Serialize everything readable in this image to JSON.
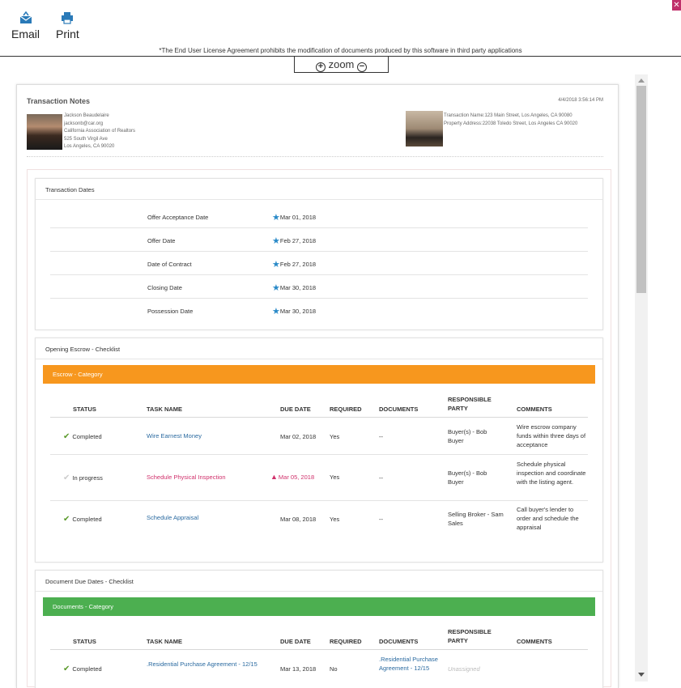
{
  "toolbar": {
    "email_label": "Email",
    "print_label": "Print",
    "close_label": "✕",
    "eula_note": "*The End User License Agreement prohibits the modification of documents produced by this software in third party applications",
    "zoom_label": "zoom",
    "zoom_in": "+",
    "zoom_out": "−"
  },
  "header": {
    "title": "Transaction Notes",
    "timestamp": "4/4/2018 3:56:14 PM",
    "agent": {
      "name": "Jackson Beaudelaire",
      "email": "jacksonb@car.org",
      "org": "California Association of Realtors",
      "address1": "525 South Virgil Ave",
      "address2": "Los Angeles, CA 90020"
    },
    "property": {
      "transaction_name": "Transaction Name:123 Main Street, Los Angeles, CA 90080",
      "property_address": "Property Address:22038 Toledo Street, Los Angeles CA 90020"
    }
  },
  "transaction_dates": {
    "title": "Transaction Dates",
    "rows": [
      {
        "label": "Offer Acceptance Date",
        "value": "Mar 01, 2018"
      },
      {
        "label": "Offer Date",
        "value": "Feb 27, 2018"
      },
      {
        "label": "Date of Contract",
        "value": "Feb 27, 2018"
      },
      {
        "label": "Closing Date",
        "value": "Mar 30, 2018"
      },
      {
        "label": "Possession Date",
        "value": "Mar 30, 2018"
      }
    ]
  },
  "columns": {
    "status": "STATUS",
    "task": "TASK NAME",
    "due": "DUE DATE",
    "required": "REQUIRED",
    "documents": "DOCUMENTS",
    "party": "RESPONSIBLE PARTY",
    "comments": "COMMENTS"
  },
  "escrow": {
    "title": "Opening Escrow - Checklist",
    "category": "Escrow - Category",
    "category_color": "#f7971e",
    "rows": [
      {
        "status": "Completed",
        "task": "Wire Earnest Money",
        "due": "Mar 02, 2018",
        "required": "Yes",
        "documents": "--",
        "party": "Buyer(s) - Bob Buyer",
        "comments": "Wire escrow company funds within three days of acceptance"
      },
      {
        "status": "In progress",
        "task": "Schedule Physical Inspection",
        "due": "Mar 05, 2018",
        "required": "Yes",
        "documents": "--",
        "party": "Buyer(s) - Bob Buyer",
        "comments": "Schedule physical inspection and coordinate with the listing agent."
      },
      {
        "status": "Completed",
        "task": "Schedule Appraisal",
        "due": "Mar 08, 2018",
        "required": "Yes",
        "documents": "--",
        "party": "Selling Broker - Sam Sales",
        "comments": "Call buyer's lender to order and schedule the appraisal"
      }
    ]
  },
  "documents": {
    "title": "Document Due Dates - Checklist",
    "category": "Documents - Category",
    "category_color": "#4caf50",
    "rows": [
      {
        "status": "Completed",
        "task": ".Residential Purchase Agreement - 12/15",
        "due": "Mar 13, 2018",
        "required": "No",
        "documents": ".Residential Purchase Agreement - 12/15",
        "party": "Unassigned",
        "comments": ""
      }
    ]
  }
}
